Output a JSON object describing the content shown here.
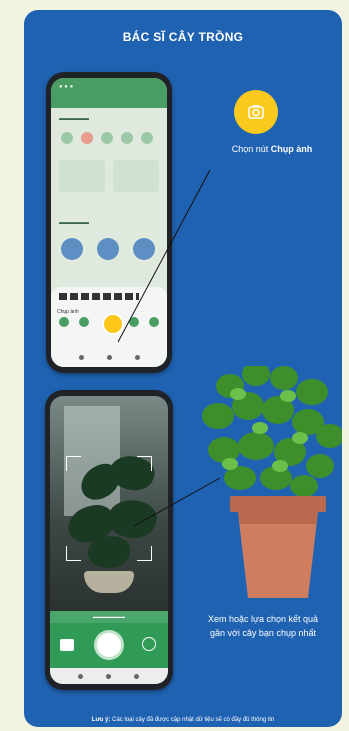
{
  "title": "BÁC SĨ CÂY TRỒNG",
  "step1": {
    "caption_prefix": "Chọn nút ",
    "caption_bold": "Chụp ảnh",
    "sheet_label": "Chụp ảnh"
  },
  "step2": {
    "caption_line1": "Xem hoặc lựa chọn kết quả",
    "caption_line2": "gần với cây bạn chụp nhất"
  },
  "note": {
    "bold": "Lưu ý:",
    "text": " Các loại cây đã được cập nhật dữ liệu sẽ có đầy đủ thông tin"
  },
  "colors": {
    "card_blue": "#1f62b2",
    "accent_yellow": "#f9c91d",
    "app_green": "#2f9b57"
  },
  "icons": {
    "camera_button": "camera-icon",
    "gallery_button": "gallery-icon",
    "illustration": "potted-plant-illustration"
  }
}
